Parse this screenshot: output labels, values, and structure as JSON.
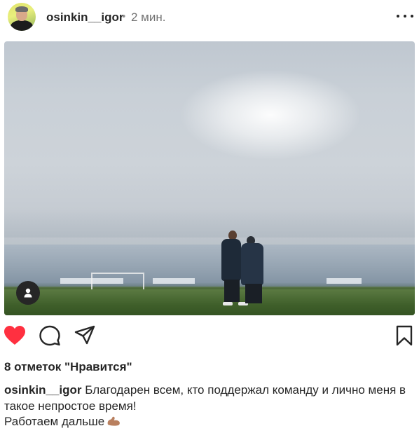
{
  "post": {
    "username": "osinkin__igor",
    "separator": "•",
    "time": "2 мин.",
    "likes": "8 отметок \"Нравится\"",
    "caption": {
      "username": "osinkin__igor",
      "text_1": "Благодарен всем, кто поддержал команду и лично меня в",
      "text_2": "такое непростое время!",
      "text_3": "Работаем дальше"
    }
  },
  "icons": {
    "more": "more-dots-icon",
    "like": "heart-filled-icon",
    "comment": "comment-bubble-icon",
    "share": "paper-plane-icon",
    "save": "bookmark-icon",
    "tagged": "user-tag-icon",
    "emoji": "flexed-biceps-emoji"
  },
  "colors": {
    "like": "#ff3040",
    "text": "#262626",
    "muted": "#737373"
  }
}
